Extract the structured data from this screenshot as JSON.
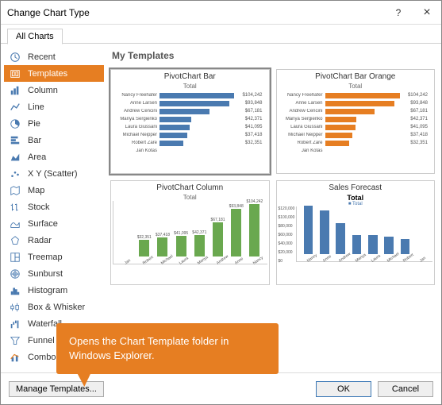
{
  "window": {
    "title": "Change Chart Type",
    "help": "?",
    "close": "×"
  },
  "tabs": {
    "all": "All Charts"
  },
  "sidebar": {
    "items": [
      {
        "label": "Recent",
        "icon": "recent-icon"
      },
      {
        "label": "Templates",
        "icon": "templates-icon",
        "selected": true
      },
      {
        "label": "Column",
        "icon": "column-icon"
      },
      {
        "label": "Line",
        "icon": "line-icon"
      },
      {
        "label": "Pie",
        "icon": "pie-icon"
      },
      {
        "label": "Bar",
        "icon": "bar-icon"
      },
      {
        "label": "Area",
        "icon": "area-icon"
      },
      {
        "label": "X Y (Scatter)",
        "icon": "scatter-icon"
      },
      {
        "label": "Map",
        "icon": "map-icon"
      },
      {
        "label": "Stock",
        "icon": "stock-icon"
      },
      {
        "label": "Surface",
        "icon": "surface-icon"
      },
      {
        "label": "Radar",
        "icon": "radar-icon"
      },
      {
        "label": "Treemap",
        "icon": "treemap-icon"
      },
      {
        "label": "Sunburst",
        "icon": "sunburst-icon"
      },
      {
        "label": "Histogram",
        "icon": "histogram-icon"
      },
      {
        "label": "Box & Whisker",
        "icon": "boxwhisker-icon"
      },
      {
        "label": "Waterfall",
        "icon": "waterfall-icon"
      },
      {
        "label": "Funnel",
        "icon": "funnel-icon"
      },
      {
        "label": "Combo",
        "icon": "combo-icon"
      }
    ]
  },
  "section": {
    "title": "My Templates"
  },
  "thumbs": {
    "t0": {
      "title": "PivotChart Bar",
      "sub": "Total",
      "color": "#4a7ab0"
    },
    "t1": {
      "title": "PivotChart Bar Orange",
      "sub": "Total",
      "color": "#E67E22"
    },
    "t2": {
      "title": "PivotChart Column",
      "sub": "Total",
      "color": "#6AA84F"
    },
    "t3": {
      "title": "Sales Forecast",
      "sub": "Total",
      "legend": "Total",
      "color": "#4a7ab0"
    }
  },
  "chart_data": [
    {
      "type": "bar",
      "orientation": "horizontal",
      "title": "PivotChart Bar",
      "subtitle": "Total",
      "categories": [
        "Nancy Freehafer",
        "Anne Larsen",
        "Andrew Cencini",
        "Mariya Sergienko",
        "Laura Giussani",
        "Michael Neipper",
        "Robert Zare",
        "Jan Kotas"
      ],
      "values": [
        104242,
        93848,
        67181,
        42371,
        41095,
        37418,
        32351,
        0
      ],
      "data_labels": [
        "$104,242",
        "$93,848",
        "$67,181",
        "$42,371",
        "$41,095",
        "$37,418",
        "$32,351",
        ""
      ],
      "xlim": [
        0,
        110000
      ],
      "series_color": "#4a7ab0"
    },
    {
      "type": "bar",
      "orientation": "horizontal",
      "title": "PivotChart Bar Orange",
      "subtitle": "Total",
      "categories": [
        "Nancy Freehafer",
        "Anne Larsen",
        "Andrew Cencini",
        "Mariya Sergienko",
        "Laura Giussani",
        "Michael Neipper",
        "Robert Zare",
        "Jan Kotas"
      ],
      "values": [
        104242,
        93848,
        67181,
        42371,
        41095,
        37418,
        32351,
        0
      ],
      "data_labels": [
        "$104,242",
        "$93,848",
        "$67,181",
        "$42,371",
        "$41,095",
        "$37,418",
        "$32,351",
        ""
      ],
      "xlim": [
        0,
        110000
      ],
      "series_color": "#E67E22"
    },
    {
      "type": "bar",
      "orientation": "vertical",
      "title": "PivotChart Column",
      "subtitle": "Total",
      "categories": [
        "Jan Kotas",
        "Robert Zare",
        "Michael Neipper",
        "Laura Giussani",
        "Mariya Sergienko",
        "Andrew Cencini",
        "Anne Larsen",
        "Nancy Freehafer"
      ],
      "values": [
        0,
        32351,
        37418,
        41095,
        42371,
        67181,
        93848,
        104242
      ],
      "data_labels": [
        "",
        "$32,351",
        "$37,418",
        "$41,095",
        "$42,371",
        "$67,181",
        "$93,848",
        "$104,242"
      ],
      "ylim": [
        0,
        110000
      ],
      "series_color": "#6AA84F"
    },
    {
      "type": "bar",
      "orientation": "vertical",
      "title": "Sales Forecast",
      "subtitle": "Total",
      "legend": [
        "Total"
      ],
      "ylabel": "",
      "categories": [
        "Nancy Freehafer",
        "Anne Larsen",
        "Andrew Cencini",
        "Mariya Sergienko",
        "Laura Giussani",
        "Michael Neipper",
        "Robert Zare",
        "Jan Kotas"
      ],
      "values": [
        104000,
        94000,
        67000,
        42000,
        41000,
        37000,
        32000,
        0
      ],
      "y_ticks": [
        0,
        20000,
        40000,
        60000,
        80000,
        100000,
        120000
      ],
      "y_tick_labels": [
        "$0",
        "$20,000",
        "$40,000",
        "$60,000",
        "$80,000",
        "$100,000",
        "$120,000"
      ],
      "ylim": [
        0,
        120000
      ],
      "series_color": "#4a7ab0"
    }
  ],
  "footer": {
    "manage": "Manage Templates...",
    "ok": "OK",
    "cancel": "Cancel"
  },
  "callout": {
    "text": "Opens the Chart Template folder in Windows Explorer."
  }
}
